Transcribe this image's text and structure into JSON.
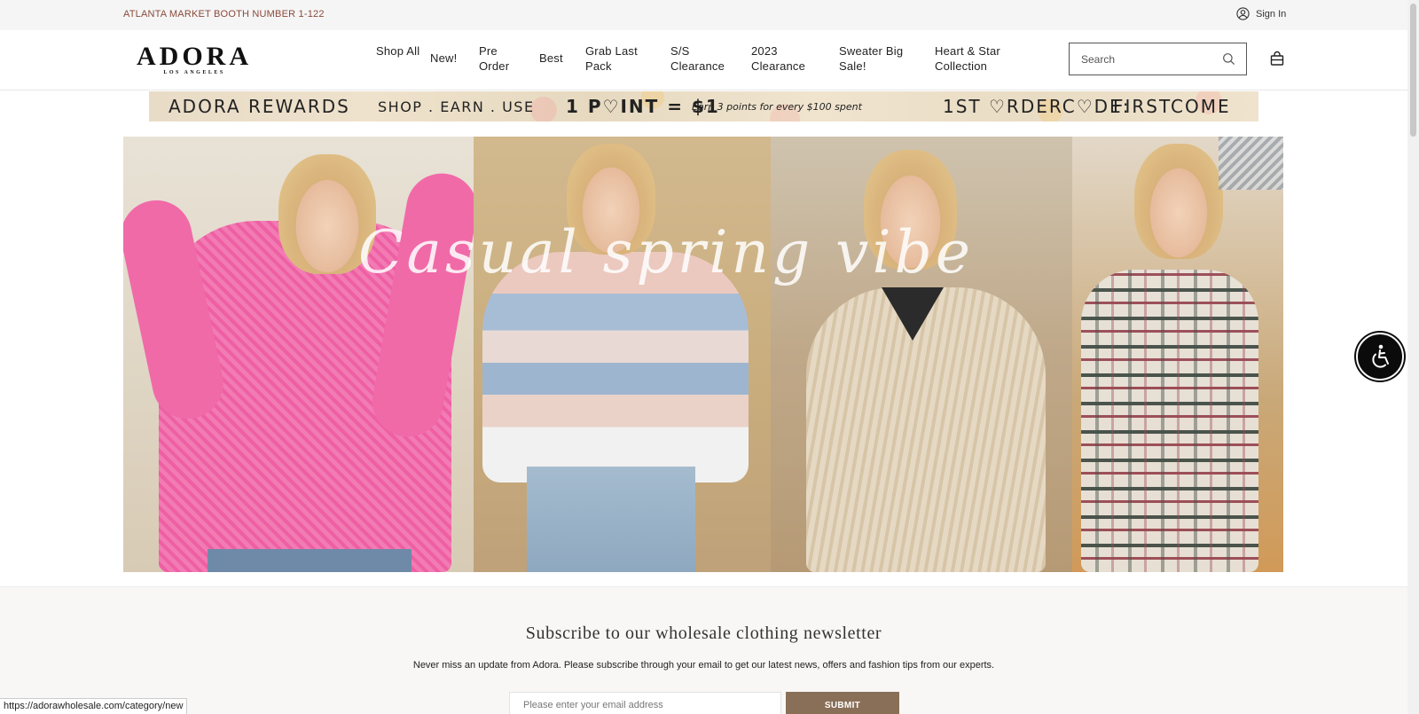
{
  "topbar": {
    "announcement": "ATLANTA MARKET BOOTH NUMBER 1-122",
    "sign_in": "Sign In"
  },
  "logo": {
    "name": "ADORA",
    "tagline": "LOS ANGELES"
  },
  "nav": [
    {
      "label": "Shop All"
    },
    {
      "label": "New!"
    },
    {
      "label": "Pre Order"
    },
    {
      "label": "Best"
    },
    {
      "label": "Grab Last Pack"
    },
    {
      "label": "S/S Clearance"
    },
    {
      "label": "2023 Clearance"
    },
    {
      "label": "Sweater Big Sale!"
    },
    {
      "label": "Heart & Star Collection"
    }
  ],
  "search": {
    "placeholder": "Search"
  },
  "rewards_banner": {
    "title": "ADORA REWARDS",
    "steps": "SHOP . EARN . USE",
    "point_value": "1 P♡INT = $1",
    "earn_text": "Earn 3 points for every $100 spent",
    "code_label": "1ST ♡RDERC♡DE:",
    "code": "FIRSTCOME"
  },
  "hero": {
    "script_text": "Casual   spring   vibe"
  },
  "newsletter": {
    "title": "Subscribe to our wholesale clothing newsletter",
    "description": "Never miss an update from Adora. Please subscribe through your email to get our latest news, offers and fashion tips from our experts.",
    "email_placeholder": "Please enter your email address",
    "submit_label": "SUBMIT"
  },
  "status_url": "https://adorawholesale.com/category/new",
  "colors": {
    "announcement": "#8a4a3a",
    "submit_bg": "#8a6f58",
    "newsletter_bg": "#f8f7f5"
  }
}
